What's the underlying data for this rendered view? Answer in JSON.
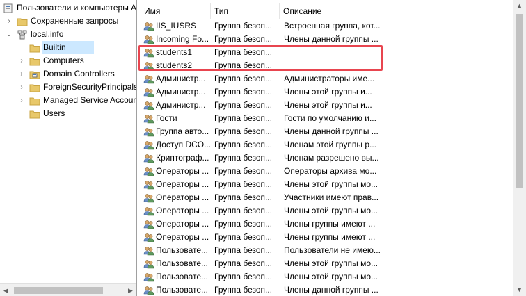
{
  "tree": {
    "root_label": "Пользователи и компьютеры А",
    "items": [
      {
        "label": "Сохраненные запросы",
        "icon": "folder-icon"
      },
      {
        "label": "local.info",
        "icon": "domain-icon"
      },
      {
        "label": "Builtin",
        "icon": "folder-icon"
      },
      {
        "label": "Computers",
        "icon": "folder-icon"
      },
      {
        "label": "Domain Controllers",
        "icon": "ou-folder-icon"
      },
      {
        "label": "ForeignSecurityPrincipals",
        "icon": "folder-icon"
      },
      {
        "label": "Managed Service Accoun",
        "icon": "folder-icon"
      },
      {
        "label": "Users",
        "icon": "folder-icon"
      }
    ]
  },
  "list": {
    "columns": {
      "name": "Имя",
      "type": "Тип",
      "description": "Описание"
    },
    "rows": [
      {
        "name": "IIS_IUSRS",
        "type": "Группа безоп...",
        "description": "Встроенная группа, кот..."
      },
      {
        "name": "Incoming Fo...",
        "type": "Группа безоп...",
        "description": "Члены данной группы ..."
      },
      {
        "name": "students1",
        "type": "Группа безоп...",
        "description": ""
      },
      {
        "name": "students2",
        "type": "Группа безоп...",
        "description": ""
      },
      {
        "name": "Администр...",
        "type": "Группа безоп...",
        "description": "Администраторы име..."
      },
      {
        "name": "Администр...",
        "type": "Группа безоп...",
        "description": "Члены этой группы и..."
      },
      {
        "name": "Администр...",
        "type": "Группа безоп...",
        "description": "Члены этой группы и..."
      },
      {
        "name": "Гости",
        "type": "Группа безоп...",
        "description": "Гости по умолчанию и..."
      },
      {
        "name": "Группа авто...",
        "type": "Группа безоп...",
        "description": "Члены данной группы ..."
      },
      {
        "name": "Доступ DCO...",
        "type": "Группа безоп...",
        "description": "Членам этой группы р..."
      },
      {
        "name": "Криптограф...",
        "type": "Группа безоп...",
        "description": "Членам разрешено вы..."
      },
      {
        "name": "Операторы ...",
        "type": "Группа безоп...",
        "description": "Операторы архива мо..."
      },
      {
        "name": "Операторы ...",
        "type": "Группа безоп...",
        "description": "Члены этой группы мо..."
      },
      {
        "name": "Операторы ...",
        "type": "Группа безоп...",
        "description": "Участники имеют прав..."
      },
      {
        "name": "Операторы ...",
        "type": "Группа безоп...",
        "description": "Члены этой группы мо..."
      },
      {
        "name": "Операторы ...",
        "type": "Группа безоп...",
        "description": "Члены группы имеют ..."
      },
      {
        "name": "Операторы ...",
        "type": "Группа безоп...",
        "description": "Члены группы имеют ..."
      },
      {
        "name": "Пользовате...",
        "type": "Группа безоп...",
        "description": "Пользователи не имею..."
      },
      {
        "name": "Пользовате...",
        "type": "Группа безоп...",
        "description": "Члены этой группы мо..."
      },
      {
        "name": "Пользовате...",
        "type": "Группа безоп...",
        "description": "Члены этой группы мо..."
      },
      {
        "name": "Пользовате...",
        "type": "Группа безоп...",
        "description": "Члены данной группы ..."
      }
    ]
  },
  "colors": {
    "selection": "#cce8ff",
    "highlight_border": "#e8454f",
    "folder": "#e8c86a"
  }
}
